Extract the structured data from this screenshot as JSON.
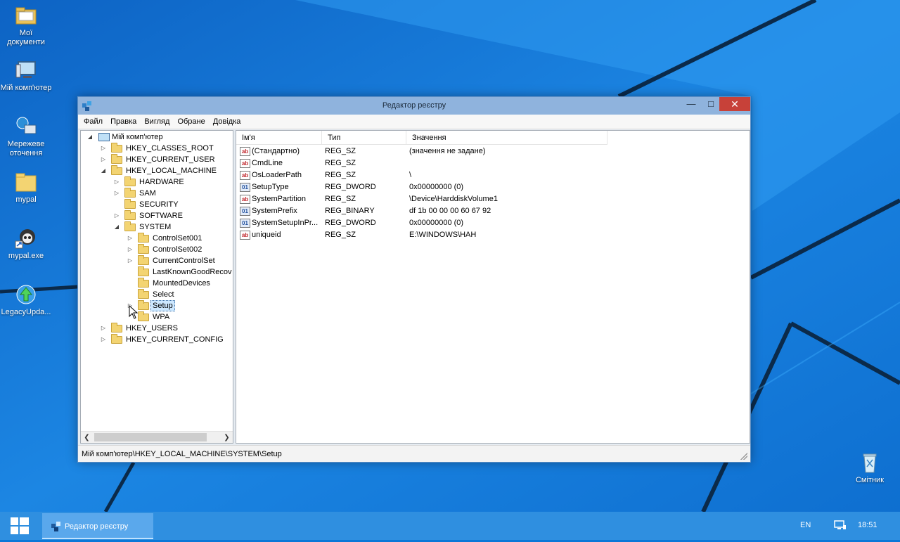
{
  "desktop": {
    "icons": [
      {
        "label": "Мої документи",
        "icon": "documents-folder-icon"
      },
      {
        "label": "Мій комп'ютер",
        "icon": "computer-icon"
      },
      {
        "label": "Мережеве оточення",
        "icon": "network-icon"
      },
      {
        "label": "mypal",
        "icon": "folder-icon"
      },
      {
        "label": "mypal.exe",
        "icon": "mypal-browser-icon"
      },
      {
        "label": "LegacyUpda...",
        "icon": "update-globe-icon"
      },
      {
        "label": "Смітник",
        "icon": "recycle-bin-icon"
      }
    ]
  },
  "window": {
    "title": "Редактор реєстру",
    "menu": [
      "Файл",
      "Правка",
      "Вигляд",
      "Обране",
      "Довідка"
    ],
    "tree": {
      "root": "Мій комп'ютер",
      "hkey_classes_root": "HKEY_CLASSES_ROOT",
      "hkey_current_user": "HKEY_CURRENT_USER",
      "hkey_local_machine": "HKEY_LOCAL_MACHINE",
      "hardware": "HARDWARE",
      "sam": "SAM",
      "security": "SECURITY",
      "software": "SOFTWARE",
      "system": "SYSTEM",
      "controlset001": "ControlSet001",
      "controlset002": "ControlSet002",
      "currentcontrolset": "CurrentControlSet",
      "lastknowngood": "LastKnownGoodRecov",
      "mounteddevices": "MountedDevices",
      "select": "Select",
      "setup": "Setup",
      "wpa": "WPA",
      "hkey_users": "HKEY_USERS",
      "hkey_current_config": "HKEY_CURRENT_CONFIG"
    },
    "columns": {
      "name": "Ім'я",
      "type": "Тип",
      "value": "Значення"
    },
    "values": [
      {
        "icon": "string-value-icon",
        "name": "(Стандартно)",
        "type": "REG_SZ",
        "data": "(значення не задане)"
      },
      {
        "icon": "string-value-icon",
        "name": "CmdLine",
        "type": "REG_SZ",
        "data": ""
      },
      {
        "icon": "string-value-icon",
        "name": "OsLoaderPath",
        "type": "REG_SZ",
        "data": "\\"
      },
      {
        "icon": "binary-value-icon",
        "name": "SetupType",
        "type": "REG_DWORD",
        "data": "0x00000000 (0)"
      },
      {
        "icon": "string-value-icon",
        "name": "SystemPartition",
        "type": "REG_SZ",
        "data": "\\Device\\HarddiskVolume1"
      },
      {
        "icon": "binary-value-icon",
        "name": "SystemPrefix",
        "type": "REG_BINARY",
        "data": "df 1b 00 00 00 60 67 92"
      },
      {
        "icon": "binary-value-icon",
        "name": "SystemSetupInPr...",
        "type": "REG_DWORD",
        "data": "0x00000000 (0)"
      },
      {
        "icon": "string-value-icon",
        "name": "uniqueid",
        "type": "REG_SZ",
        "data": "E:\\WINDOWS\\HAH"
      }
    ],
    "status_path": "Мій комп'ютер\\HKEY_LOCAL_MACHINE\\SYSTEM\\Setup"
  },
  "taskbar": {
    "task_label": "Редактор реєстру",
    "language": "EN",
    "clock": "18:51"
  },
  "colors": {
    "desktop_blue": "#0a78d8",
    "taskbar": "#2f8fe0",
    "close_button": "#c74139"
  }
}
